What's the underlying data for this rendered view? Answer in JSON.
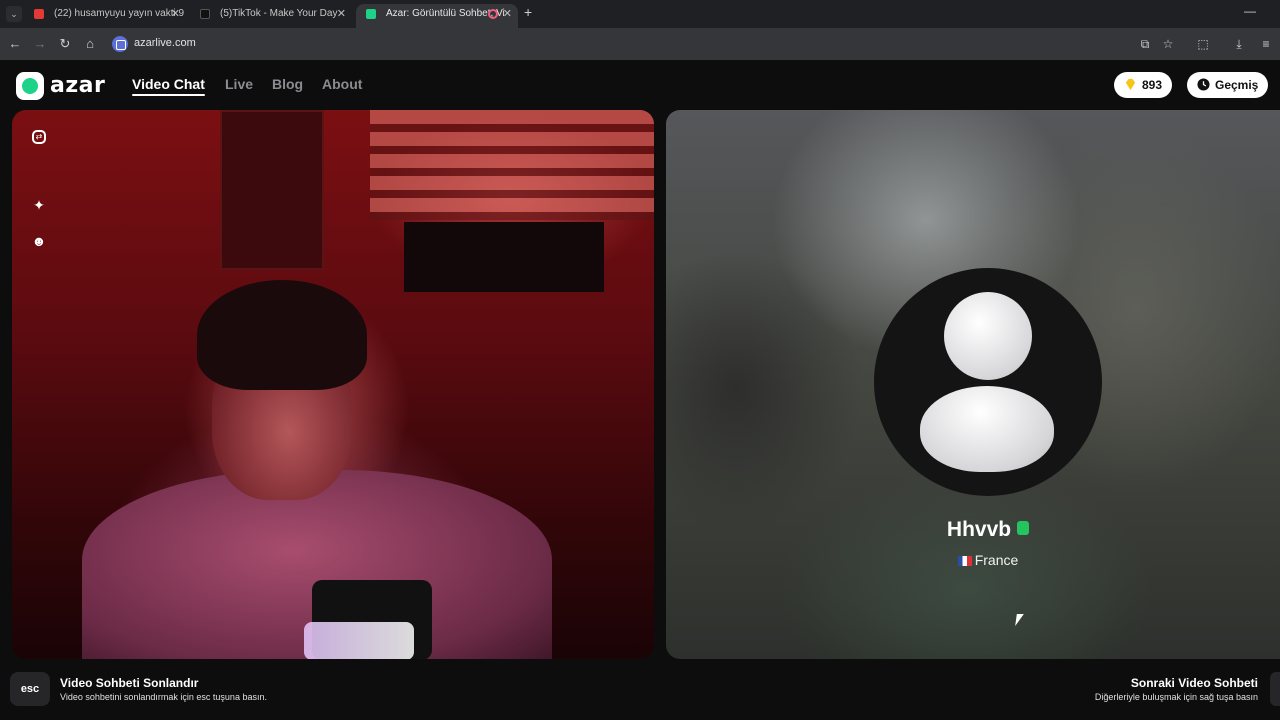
{
  "browser": {
    "tabs": [
      {
        "title": "(22) husamyuyu yayın vakti 9 -",
        "favicon_color": "#e53935"
      },
      {
        "title": "(5)TikTok - Make Your Day",
        "favicon_color": "#111111"
      },
      {
        "title": "Azar: Görüntülü Sohbet, Vi",
        "favicon_color": "#1ed388"
      }
    ],
    "url": "azarlive.com"
  },
  "app": {
    "logo": "azar",
    "nav": [
      "Video Chat",
      "Live",
      "Blog",
      "About"
    ],
    "gems": "893",
    "history_label": "Geçmiş"
  },
  "peer": {
    "name": "Hhvvb",
    "country": "France"
  },
  "bottom": {
    "esc_key": "esc",
    "end_title": "Video Sohbeti Sonlandır",
    "end_sub": "Video sohbetini sonlandırmak için esc tuşuna basın.",
    "next_title": "Sonraki Video Sohbeti",
    "next_sub": "Diğerleriyle buluşmak için sağ tuşa basın"
  },
  "colors": {
    "accent": "#1ed388",
    "verified": "#23c55e",
    "gem": "#f5c518"
  }
}
